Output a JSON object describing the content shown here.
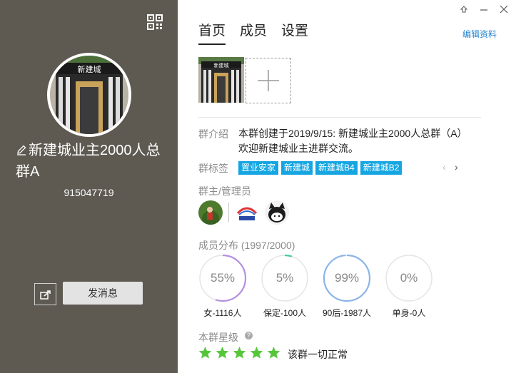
{
  "window": {
    "controls": [
      "pin-icon",
      "minimize-icon",
      "close-icon"
    ]
  },
  "left_panel": {
    "background": "#5e5a51",
    "group_name": "新建城业主2000人总群A",
    "group_id": "915047719",
    "avatar_sign": "新建城",
    "send_message_label": "发消息"
  },
  "tabs": [
    "首页",
    "成员",
    "设置"
  ],
  "active_tab": "首页",
  "edit_profile_label": "编辑资料",
  "photo_sign": "新建城",
  "intro": {
    "label": "群介绍",
    "text": "本群创建于2019/9/15:  新建城业主2000人总群（A）欢迎新建城业主进群交流。"
  },
  "tags": {
    "label": "群标签",
    "items": [
      "置业安家",
      "新建城",
      "新建城B4",
      "新建城B2"
    ],
    "accent": "#15a6e2"
  },
  "admins": {
    "label": "群主/管理员"
  },
  "distribution": {
    "label": "成员分布 (1997/2000)",
    "items": [
      {
        "percent_label": "55%",
        "fraction": 0.55,
        "caption": "女-1116人",
        "color": "#b48fe0"
      },
      {
        "percent_label": "5%",
        "fraction": 0.05,
        "caption": "保定-100人",
        "color": "#3fcf9a"
      },
      {
        "percent_label": "99%",
        "fraction": 0.99,
        "caption": "90后-1987人",
        "color": "#8ab4e8"
      },
      {
        "percent_label": "0%",
        "fraction": 0.0,
        "caption": "单身-0人",
        "color": "#cccccc"
      }
    ]
  },
  "level": {
    "label": "本群星级",
    "stars": 5,
    "status_text": "该群一切正常",
    "star_color": "#55c63a"
  }
}
